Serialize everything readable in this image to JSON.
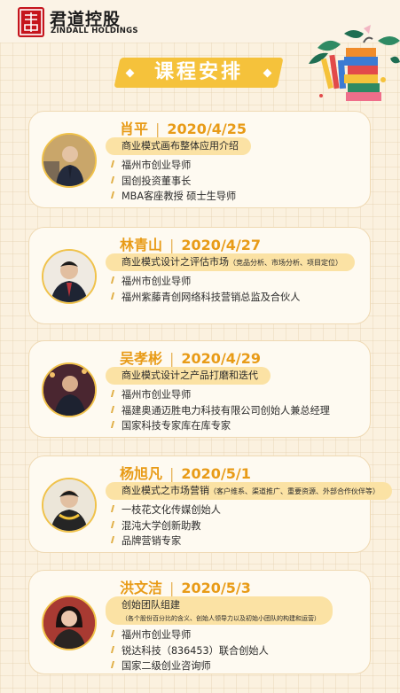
{
  "brand": {
    "cn": "君道控股",
    "en": "ZINDALL HOLDINGS"
  },
  "title": "课程安排",
  "speakers": [
    {
      "name": "肖平",
      "date": "2020/4/25",
      "topic": "商业模式画布整体应用介绍",
      "topic_note": "",
      "lines": [
        "福州市创业导师",
        "国创投资董事长",
        "MBA客座教授 硕士生导师"
      ],
      "avatar_bg": "#b9975b"
    },
    {
      "name": "林青山",
      "date": "2020/4/27",
      "topic": "商业模式设计之评估市场",
      "topic_note": "（竞品分析、市场分析、项目定位）",
      "lines": [
        "福州市创业导师",
        "福州紫藤青创网络科技营销总监及合伙人"
      ],
      "avatar_bg": "#e8e3dc"
    },
    {
      "name": "吴孝彬",
      "date": "2020/4/29",
      "topic": "商业模式设计之产品打磨和迭代",
      "topic_note": "",
      "lines": [
        "福州市创业导师",
        "福建奥通迈胜电力科技有限公司创始人兼总经理",
        "国家科技专家库在库专家"
      ],
      "avatar_bg": "#5a2a36"
    },
    {
      "name": "杨旭凡",
      "date": "2020/5/1",
      "topic": "商业模式之市场营销",
      "topic_note": "（客户维系、渠道推广、重要资源、外部合作伙伴等）",
      "lines": [
        "一枝花文化传媒创始人",
        "混沌大学创新助教",
        "品牌营销专家"
      ],
      "avatar_bg": "#e9e4d8"
    },
    {
      "name": "洪文洁",
      "date": "2020/5/3",
      "topic": "创始团队组建",
      "topic_note": "（各个股份百分比的含义、创始人领导力以及初始小团队的构建和运营）",
      "lines": [
        "福州市创业导师",
        "锐达科技（836453）联合创始人",
        "国家二级创业咨询师"
      ],
      "avatar_bg": "#9a2a2a"
    }
  ]
}
